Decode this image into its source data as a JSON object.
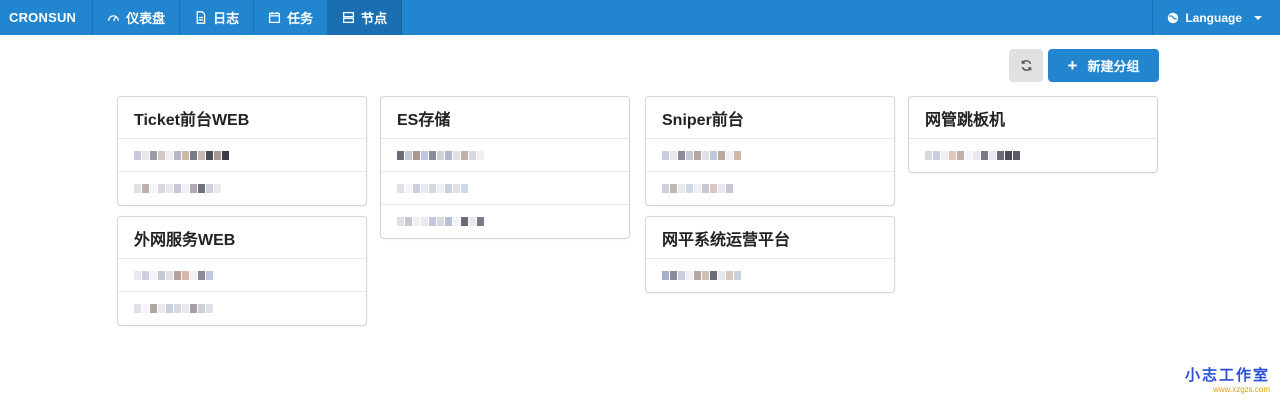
{
  "navbar": {
    "brand": "CRONSUN",
    "items": [
      {
        "label": "仪表盘",
        "icon": "dashboard-icon",
        "active": false
      },
      {
        "label": "日志",
        "icon": "file-icon",
        "active": false
      },
      {
        "label": "任务",
        "icon": "calendar-icon",
        "active": false
      },
      {
        "label": "节点",
        "icon": "server-icon",
        "active": true
      }
    ],
    "language": "Language"
  },
  "toolbar": {
    "refresh_icon": "refresh-icon",
    "new_group_label": "新建分组",
    "plus_icon": "plus-icon"
  },
  "groups": [
    {
      "name": "Ticket前台WEB"
    },
    {
      "name": "外网服务WEB"
    },
    {
      "name": "ES存储"
    },
    {
      "name": "Sniper前台"
    },
    {
      "name": "网平系统运营平台"
    },
    {
      "name": "网管跳板机"
    }
  ],
  "watermark": {
    "title": "小志工作室",
    "url": "www.xzgzs.com"
  },
  "colors": {
    "primary": "#2185d0",
    "active_nav": "#1a6fb0"
  }
}
